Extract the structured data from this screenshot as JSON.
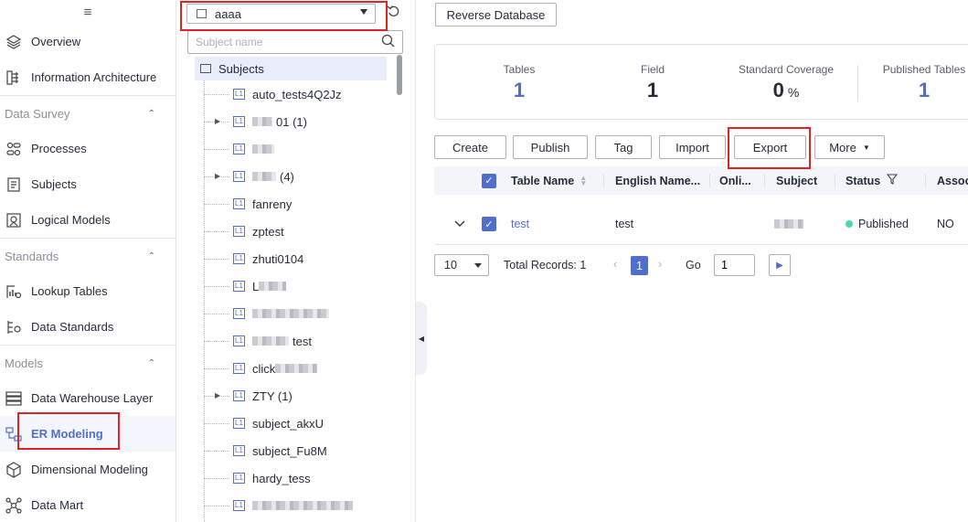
{
  "nav": {
    "menu_icon": "hamburger-icon",
    "items_top": [
      {
        "label": "Overview",
        "icon": "layers-icon"
      },
      {
        "label": "Information Architecture",
        "icon": "architecture-icon"
      }
    ],
    "groups": [
      {
        "label": "Data Survey",
        "items": [
          {
            "label": "Processes",
            "icon": "process-icon"
          },
          {
            "label": "Subjects",
            "icon": "subject-icon"
          },
          {
            "label": "Logical Models",
            "icon": "logical-model-icon"
          }
        ]
      },
      {
        "label": "Standards",
        "items": [
          {
            "label": "Lookup Tables",
            "icon": "lookup-table-icon"
          },
          {
            "label": "Data Standards",
            "icon": "data-standard-icon"
          }
        ]
      },
      {
        "label": "Models",
        "items": [
          {
            "label": "Data Warehouse Layer",
            "icon": "warehouse-icon"
          },
          {
            "label": "ER Modeling",
            "icon": "er-model-icon",
            "active": true
          },
          {
            "label": "Dimensional Modeling",
            "icon": "cube-icon"
          },
          {
            "label": "Data Mart",
            "icon": "data-mart-icon"
          }
        ]
      }
    ]
  },
  "tree_pane": {
    "workspace": "aaaa",
    "search_placeholder": "Subject name",
    "root": "Subjects",
    "level_tag": "L1",
    "nodes": [
      {
        "label": "auto_tests4Q2Jz"
      },
      {
        "label": "01 (1)",
        "expandable": true
      },
      {
        "label": ""
      },
      {
        "label": "(4)",
        "expandable": true
      },
      {
        "label": "fanreny"
      },
      {
        "label": "zptest"
      },
      {
        "label": "zhuti0104"
      },
      {
        "label": "L"
      },
      {
        "label": ""
      },
      {
        "label": "test"
      },
      {
        "label": "click"
      },
      {
        "label": "ZTY (1)",
        "expandable": true
      },
      {
        "label": "subject_akxU"
      },
      {
        "label": "subject_Fu8M"
      },
      {
        "label": "hardy_tess"
      },
      {
        "label": ""
      }
    ]
  },
  "main": {
    "reverse_button": "Reverse Database",
    "stats": [
      {
        "title": "Tables",
        "value": "1"
      },
      {
        "title": "Field",
        "value": "1"
      },
      {
        "title": "Standard Coverage",
        "value": "0",
        "unit": "%"
      },
      {
        "title": "Published Tables",
        "value": "1"
      }
    ],
    "toolbar": {
      "create": "Create",
      "publish": "Publish",
      "tag": "Tag",
      "import": "Import",
      "export": "Export",
      "more": "More"
    },
    "table": {
      "columns": [
        "Table Name",
        "English Name...",
        "Onli...",
        "Subject",
        "Status",
        "Assoc"
      ],
      "rows": [
        {
          "table_name": "test",
          "english_name": "test",
          "subject": "",
          "status": "Published",
          "assoc": "NO"
        }
      ]
    },
    "pager": {
      "page_size": "10",
      "total": "Total Records: 1",
      "current_page": "1",
      "go_label": "Go",
      "go_value": "1"
    }
  },
  "colors": {
    "accent": "#526ecc",
    "highlight": "#e02424",
    "published": "#50d4ab"
  }
}
